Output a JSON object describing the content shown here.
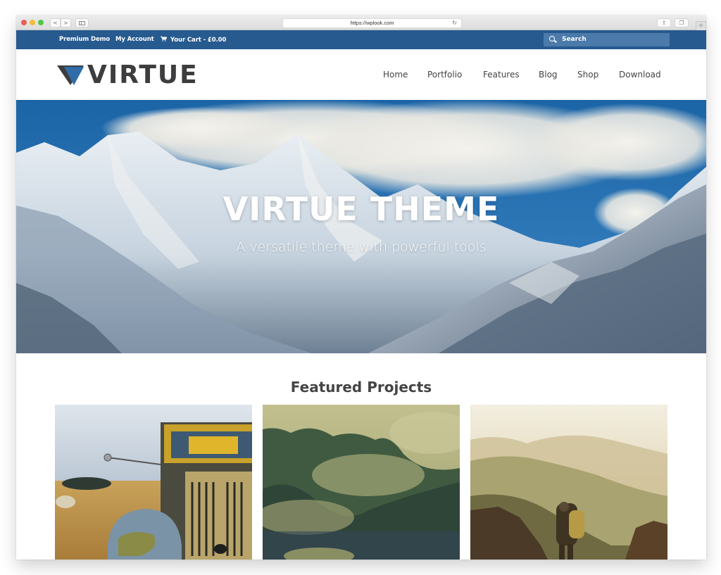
{
  "browser": {
    "url": "https://wplook.com",
    "buttons": {
      "back": "<",
      "forward": ">",
      "reload": "↻",
      "share": "⇪",
      "tabs": "❐",
      "new_tab": "+"
    }
  },
  "topbar": {
    "links": [
      {
        "label": "Premium Demo"
      },
      {
        "label": "My Account"
      },
      {
        "label": "Your Cart - £0.00",
        "icon": "cart-icon"
      }
    ],
    "search_placeholder": "Search",
    "cart_glyph": "🛒"
  },
  "header": {
    "logo_text": "VIRTUE",
    "nav": [
      {
        "label": "Home"
      },
      {
        "label": "Portfolio"
      },
      {
        "label": "Features"
      },
      {
        "label": "Blog"
      },
      {
        "label": "Shop"
      },
      {
        "label": "Download"
      }
    ]
  },
  "hero": {
    "title": "VIRTUE THEME",
    "subtitle": "A versatile theme with powerful tools",
    "image": "snowy-mountains-with-clouds"
  },
  "featured": {
    "title": "Featured Projects",
    "projects": [
      {
        "image": "rusty-vintage-truck-in-field"
      },
      {
        "image": "misty-forest-hillside"
      },
      {
        "image": "hiker-overlooking-hazy-mountains"
      }
    ]
  },
  "colors": {
    "topbar_blue": "#275a8f",
    "search_blue": "#4b7aab",
    "logo_dark": "#3d3d3f",
    "logo_blue": "#2f6ca8",
    "nav_text": "#444444"
  }
}
